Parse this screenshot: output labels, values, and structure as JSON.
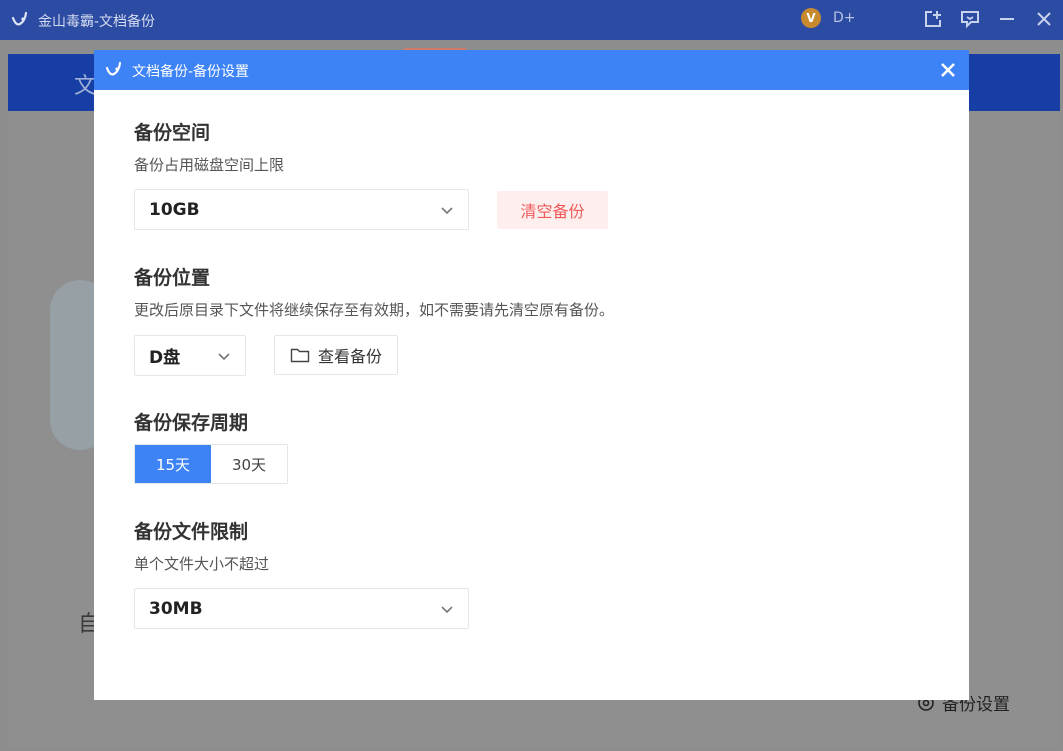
{
  "window": {
    "title": "金山毒霸-文档备份",
    "vip_badge": "V",
    "vip_level": "D+",
    "controls": [
      "new-window-icon",
      "feedback-icon",
      "minimize-icon",
      "close-icon"
    ]
  },
  "background": {
    "tab_text": "文",
    "side_text": "自",
    "settings_label": "备份设置"
  },
  "dialog": {
    "title": "文档备份-备份设置",
    "accent_color": "#3d83f5",
    "space": {
      "title": "备份空间",
      "desc": "备份占用磁盘空间上限",
      "value": "10GB",
      "clear_label": "清空备份"
    },
    "location": {
      "title": "备份位置",
      "desc": "更改后原目录下文件将继续保存至有效期，如不需要请先清空原有备份。",
      "drive": "D盘",
      "view_label": "查看备份"
    },
    "period": {
      "title": "备份保存周期",
      "options": [
        "15天",
        "30天"
      ],
      "selected": "15天"
    },
    "limit": {
      "title": "备份文件限制",
      "desc": "单个文件大小不超过",
      "value": "30MB"
    }
  }
}
